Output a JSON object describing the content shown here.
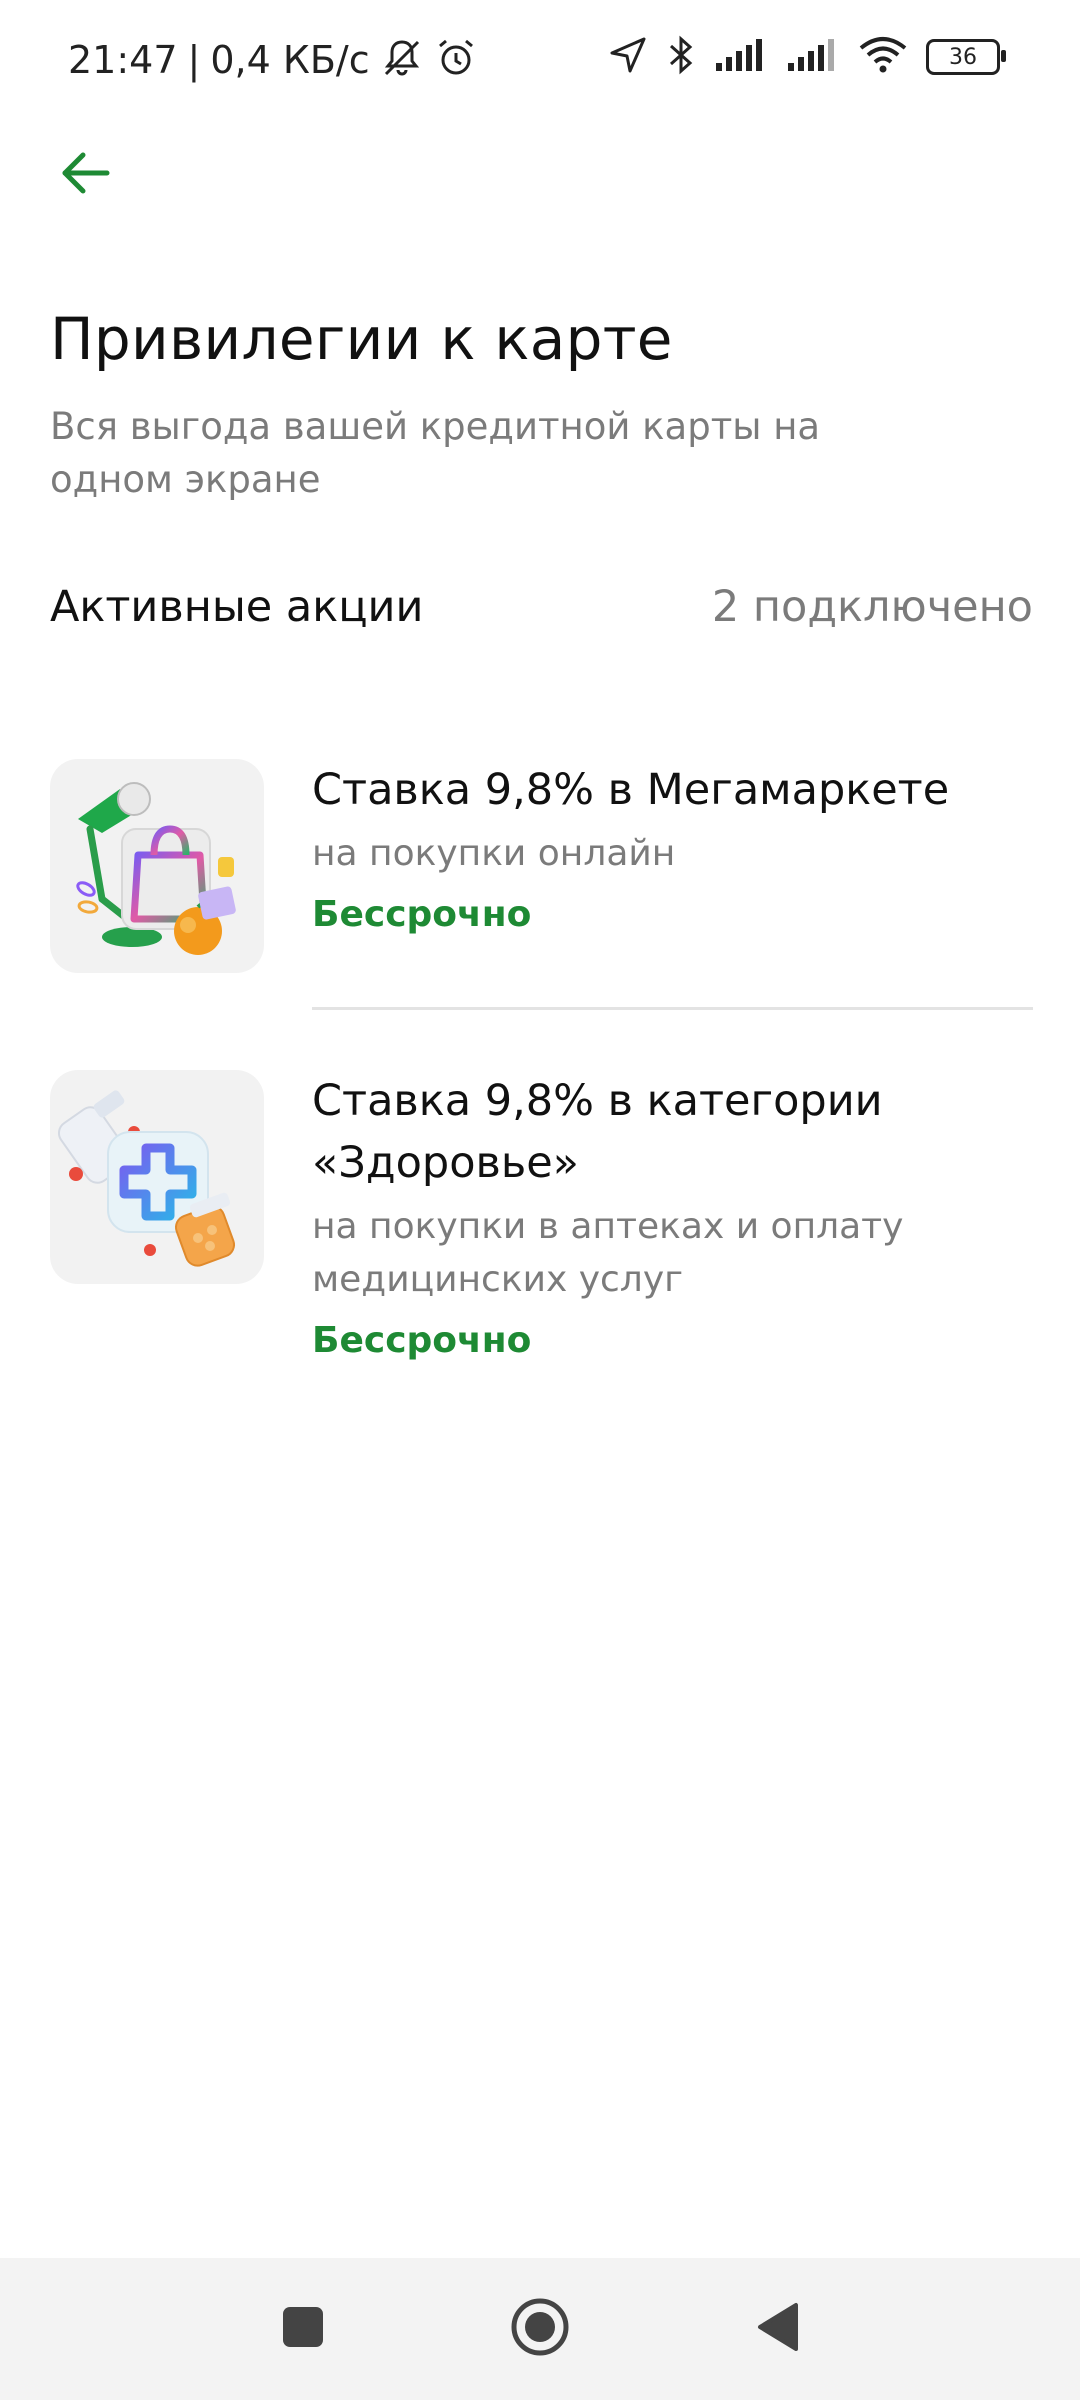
{
  "status_bar": {
    "time": "21:47",
    "separator": "|",
    "network_speed": "0,4 КБ/с",
    "battery_level": "36",
    "icons": [
      "mute-icon",
      "alarm-icon",
      "location-icon",
      "bluetooth-icon",
      "signal-icon",
      "signal-icon",
      "wifi-icon",
      "battery-icon"
    ]
  },
  "header": {
    "back_icon": "arrow-left-icon",
    "title": "Привилегии к карте",
    "subtitle": "Вся выгода вашей кредитной карты на одном экране"
  },
  "section": {
    "title": "Активные акции",
    "count": "2 подключено"
  },
  "promos": [
    {
      "image": "megamarket-bag-lamp-illustration",
      "title": "Ставка 9,8% в Мегамаркете",
      "description": "на покупки онлайн",
      "term": "Бессрочно"
    },
    {
      "image": "health-pills-cross-illustration",
      "title": "Ставка 9,8% в категории «Здоровье»",
      "description": "на покупки в аптеках и оплату медицинских услуг",
      "term": "Бессрочно"
    }
  ],
  "nav_bar": {
    "icons": [
      "recents-square-icon",
      "home-circle-icon",
      "back-triangle-icon"
    ]
  },
  "colors": {
    "accent_green": "#1e8a34",
    "secondary_text": "#7b7b7b",
    "nav_background": "#f3f3f3"
  }
}
